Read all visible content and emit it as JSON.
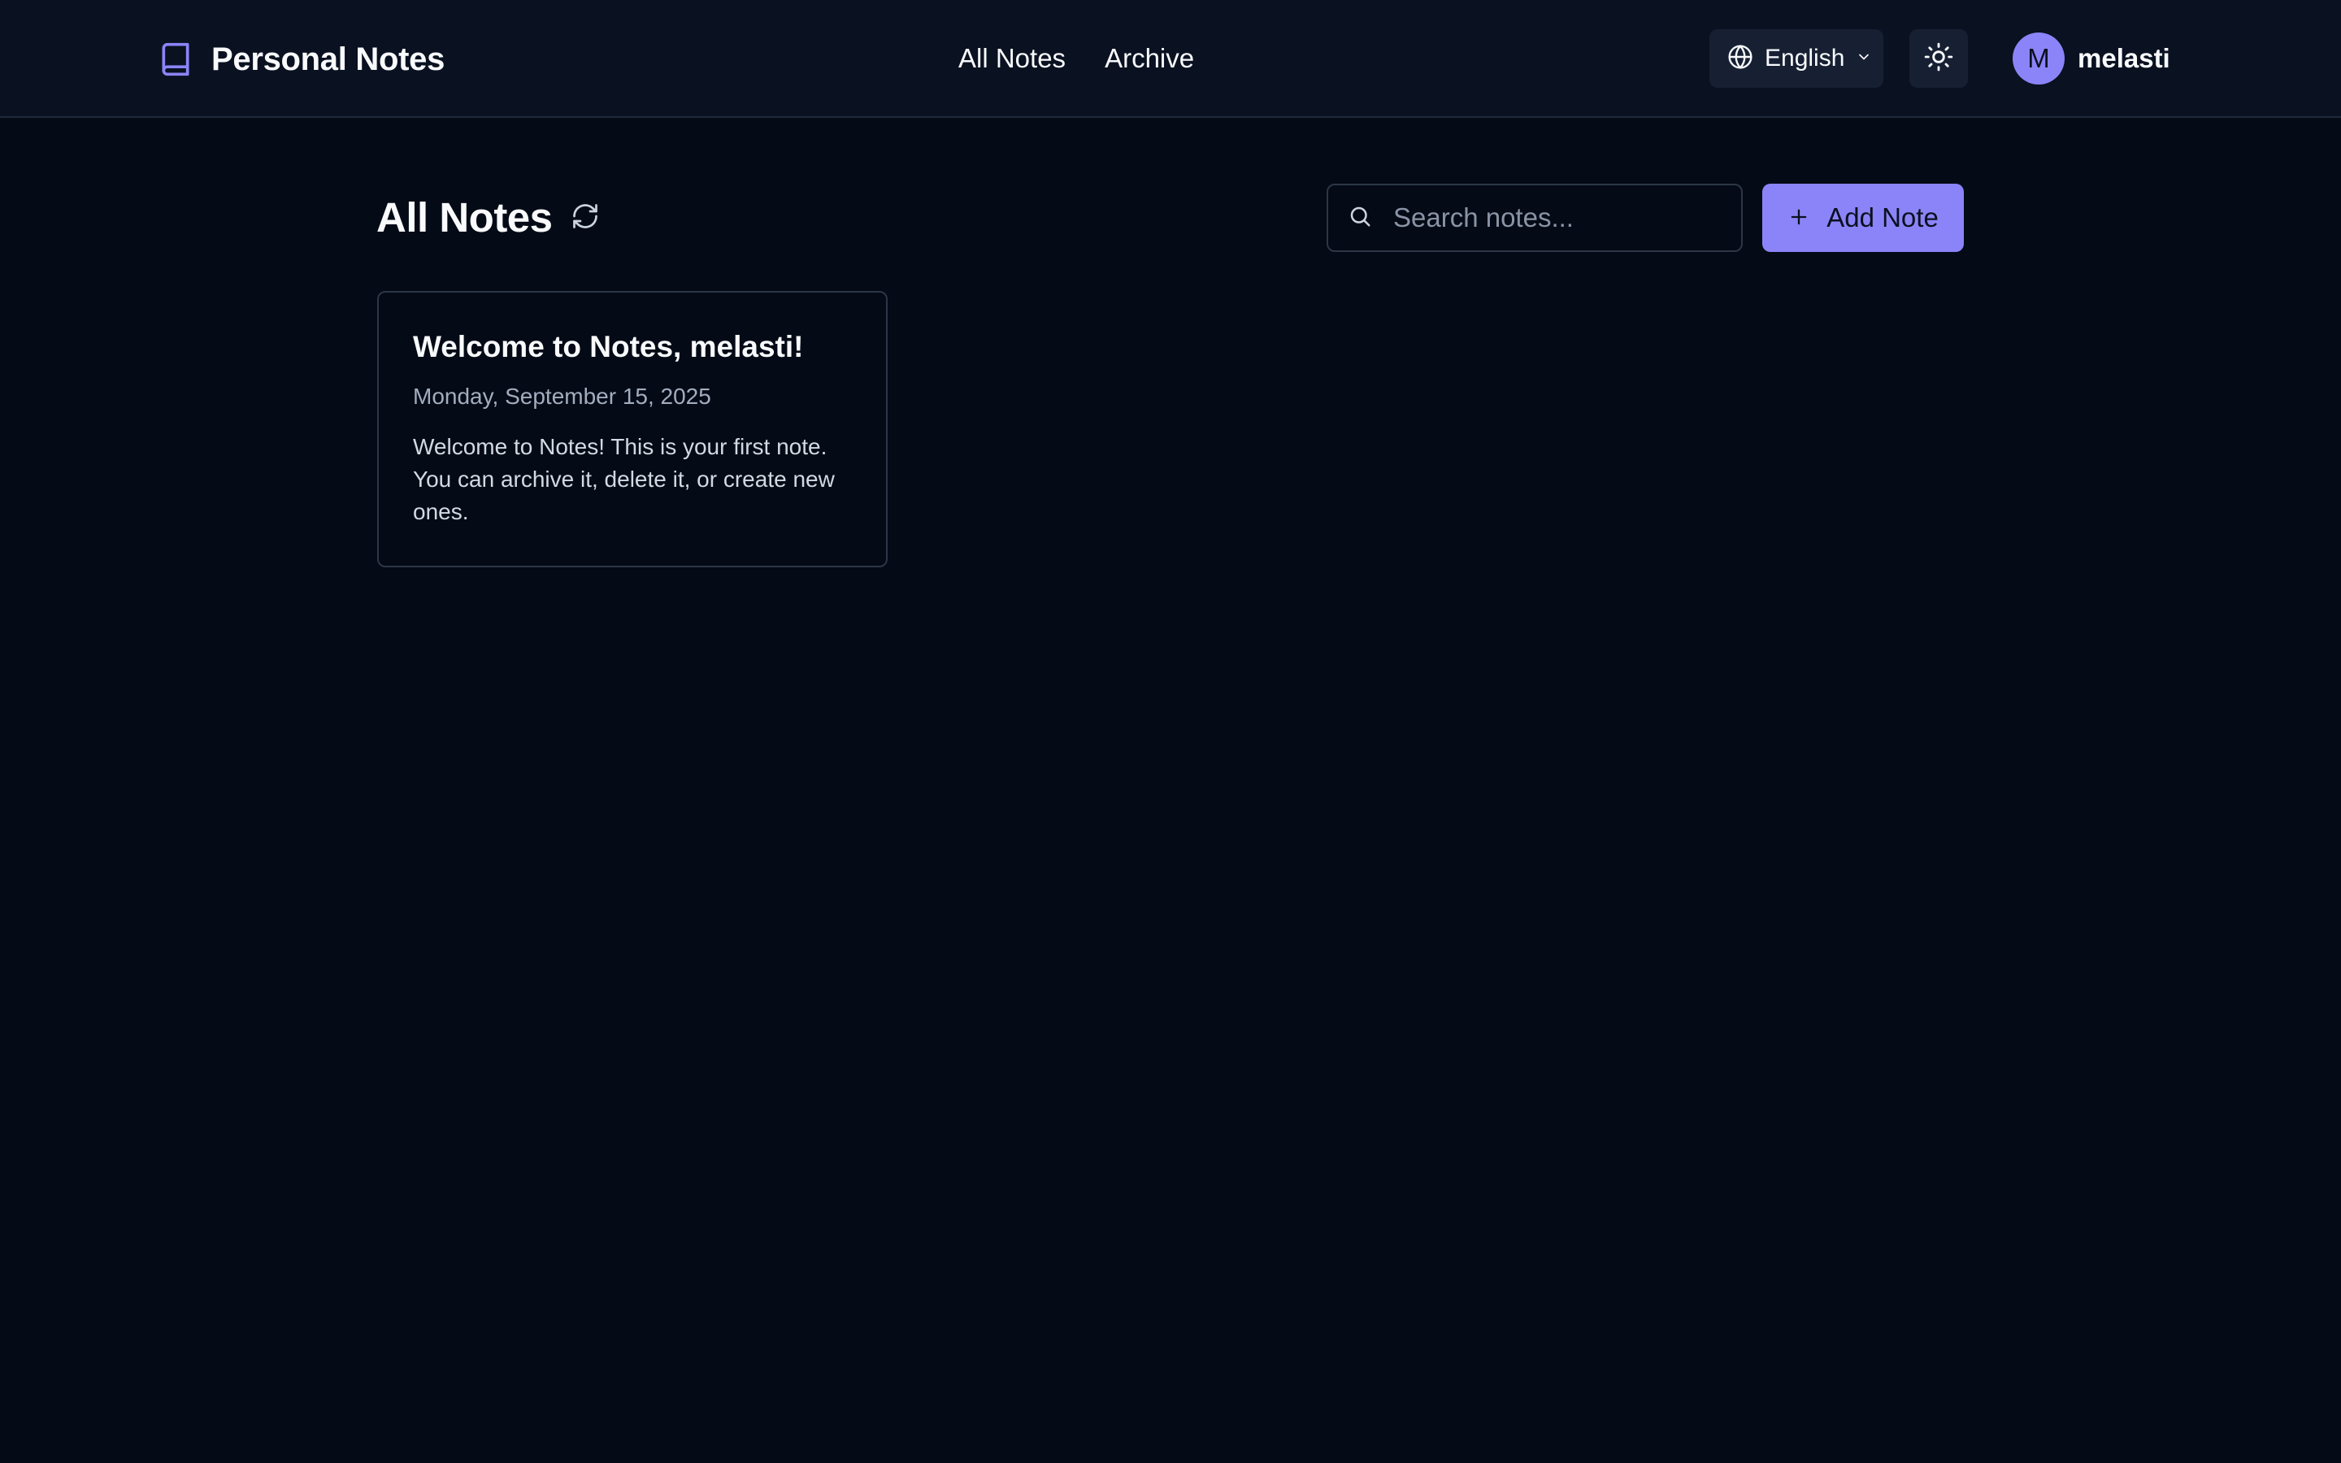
{
  "header": {
    "brand_title": "Personal Notes",
    "brand_icon": "book-icon",
    "nav": [
      {
        "label": "All Notes"
      },
      {
        "label": "Archive"
      }
    ],
    "language": {
      "label": "English",
      "icon": "globe-icon"
    },
    "theme_icon": "sun-icon",
    "user": {
      "initial": "M",
      "name": "melasti"
    }
  },
  "main": {
    "title": "All Notes",
    "search": {
      "placeholder": "Search notes...",
      "value": ""
    },
    "add_note_label": "Add Note"
  },
  "notes": [
    {
      "title": "Welcome to Notes, melasti!",
      "date": "Monday, September 15, 2025",
      "body": "Welcome to Notes! This is your first note. You can archive it, delete it, or create new ones."
    }
  ],
  "colors": {
    "background": "#040b16",
    "header": "#0a1120",
    "accent": "#8b84f8",
    "border": "#2c3647"
  }
}
